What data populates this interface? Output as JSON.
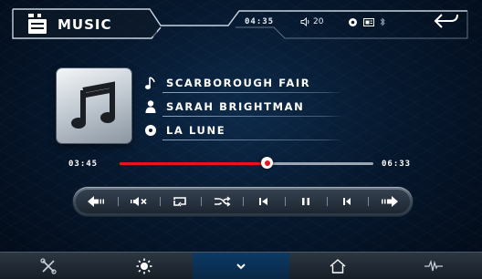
{
  "header": {
    "app_icon": "music-app-icon",
    "title": "MUSIC",
    "clock": "04:35",
    "volume_icon": "speaker-icon",
    "volume": "20",
    "status_icons": [
      "circle-indicator-icon",
      "card-icon",
      "bluetooth-icon"
    ],
    "back_icon": "back-arrow-icon"
  },
  "track": {
    "album_art_icon": "music-note-icon",
    "title_icon": "note-icon",
    "title": "SCARBOROUGH FAIR",
    "artist_icon": "person-icon",
    "artist": "SARAH BRIGHTMAN",
    "album_icon": "disc-icon",
    "album": "LA LUNE"
  },
  "playback": {
    "elapsed": "03:45",
    "total": "06:33",
    "progress_fraction": 0.58,
    "progress_color": "#e8141c"
  },
  "controls": [
    {
      "name": "rewind-button",
      "icon": "rewind-icon"
    },
    {
      "name": "mute-button",
      "icon": "mute-icon"
    },
    {
      "name": "repeat-button",
      "icon": "repeat-icon"
    },
    {
      "name": "shuffle-button",
      "icon": "shuffle-icon"
    },
    {
      "name": "previous-button",
      "icon": "skip-previous-icon"
    },
    {
      "name": "pause-button",
      "icon": "pause-icon"
    },
    {
      "name": "next-button",
      "icon": "skip-next-icon"
    },
    {
      "name": "fast-forward-button",
      "icon": "fast-forward-icon"
    }
  ],
  "bottom_nav": [
    {
      "name": "nav-settings",
      "icon": "tools-icon"
    },
    {
      "name": "nav-brightness",
      "icon": "brightness-icon"
    },
    {
      "name": "nav-collapse",
      "icon": "chevron-down-icon",
      "active": true
    },
    {
      "name": "nav-home",
      "icon": "home-icon"
    },
    {
      "name": "nav-equalizer",
      "icon": "waveform-icon"
    }
  ],
  "colors": {
    "accent_red": "#e8141c",
    "background": "#06182e",
    "active_nav": "#0d3a66"
  }
}
